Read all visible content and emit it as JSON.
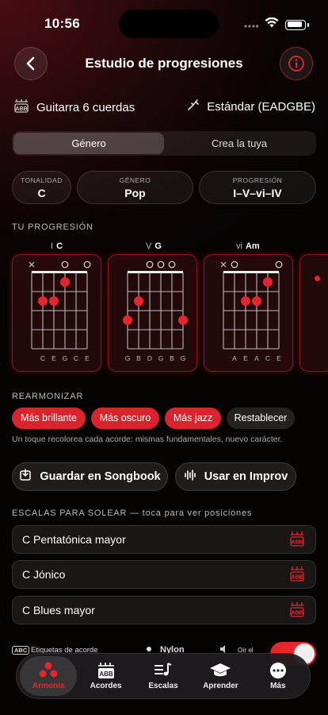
{
  "status": {
    "time": "10:56"
  },
  "header": {
    "title": "Estudio de progresiones"
  },
  "instrument": {
    "name": "Guitarra 6 cuerdas",
    "tuning": "Estándar (EADGBE)"
  },
  "segment": {
    "tabs": [
      "Género",
      "Crea la tuya"
    ],
    "selected": 0
  },
  "params": {
    "tonalidad": {
      "label": "TONALIDAD",
      "value": "C"
    },
    "genero": {
      "label": "GÉNERO",
      "value": "Pop"
    },
    "progresion": {
      "label": "PROGRESIÓN",
      "value": "I–V–vi–IV"
    }
  },
  "progression": {
    "section_title": "TU PROGRESIÓN",
    "chords": [
      {
        "roman": "I",
        "name": "C",
        "top": [
          "x",
          "",
          "",
          "o",
          "",
          "o"
        ],
        "dots": [
          [
            1,
            2,
            3
          ],
          [
            2,
            2,
            2
          ],
          [
            3,
            1,
            1
          ]
        ],
        "notes": [
          "",
          "C",
          "E",
          "G",
          "C",
          "E"
        ]
      },
      {
        "roman": "V",
        "name": "G",
        "top": [
          "",
          "",
          "o",
          "o",
          "o",
          ""
        ],
        "dots": [
          [
            0,
            3,
            3
          ],
          [
            1,
            2,
            2
          ],
          [
            5,
            3,
            3
          ]
        ],
        "notes": [
          "G",
          "B",
          "D",
          "G",
          "B",
          "G"
        ]
      },
      {
        "roman": "vi",
        "name": "Am",
        "top": [
          "x",
          "o",
          "",
          "",
          "",
          "o"
        ],
        "dots": [
          [
            2,
            2,
            2
          ],
          [
            3,
            2,
            2
          ],
          [
            4,
            1,
            1
          ]
        ],
        "notes": [
          "",
          "A",
          "E",
          "A",
          "C",
          "E"
        ]
      }
    ]
  },
  "reharm": {
    "section_title": "REARMONIZAR",
    "buttons": [
      "Más brillante",
      "Más oscuro",
      "Más jazz",
      "Restablecer"
    ],
    "hint": "Un toque recolorea cada acorde: mismas fundamentales, nuevo carácter."
  },
  "actions": {
    "save": "Guardar en Songbook",
    "improv": "Usar en Improv"
  },
  "scales": {
    "section_title": "ESCALAS PARA SOLEAR — toca para ver posiciones",
    "items": [
      "C Pentatónica mayor",
      "C Jónico",
      "C Blues mayor"
    ]
  },
  "options": {
    "labels": "Etiquetas de acorde",
    "abc": "ABC",
    "sound": "Nylon",
    "listen": "Oír el"
  },
  "tabbar": {
    "items": [
      "Armonía",
      "Acordes",
      "Escalas",
      "Aprender",
      "Más"
    ],
    "selected": 0
  },
  "colors": {
    "accent": "#e6262f",
    "background": "#0a0304"
  }
}
